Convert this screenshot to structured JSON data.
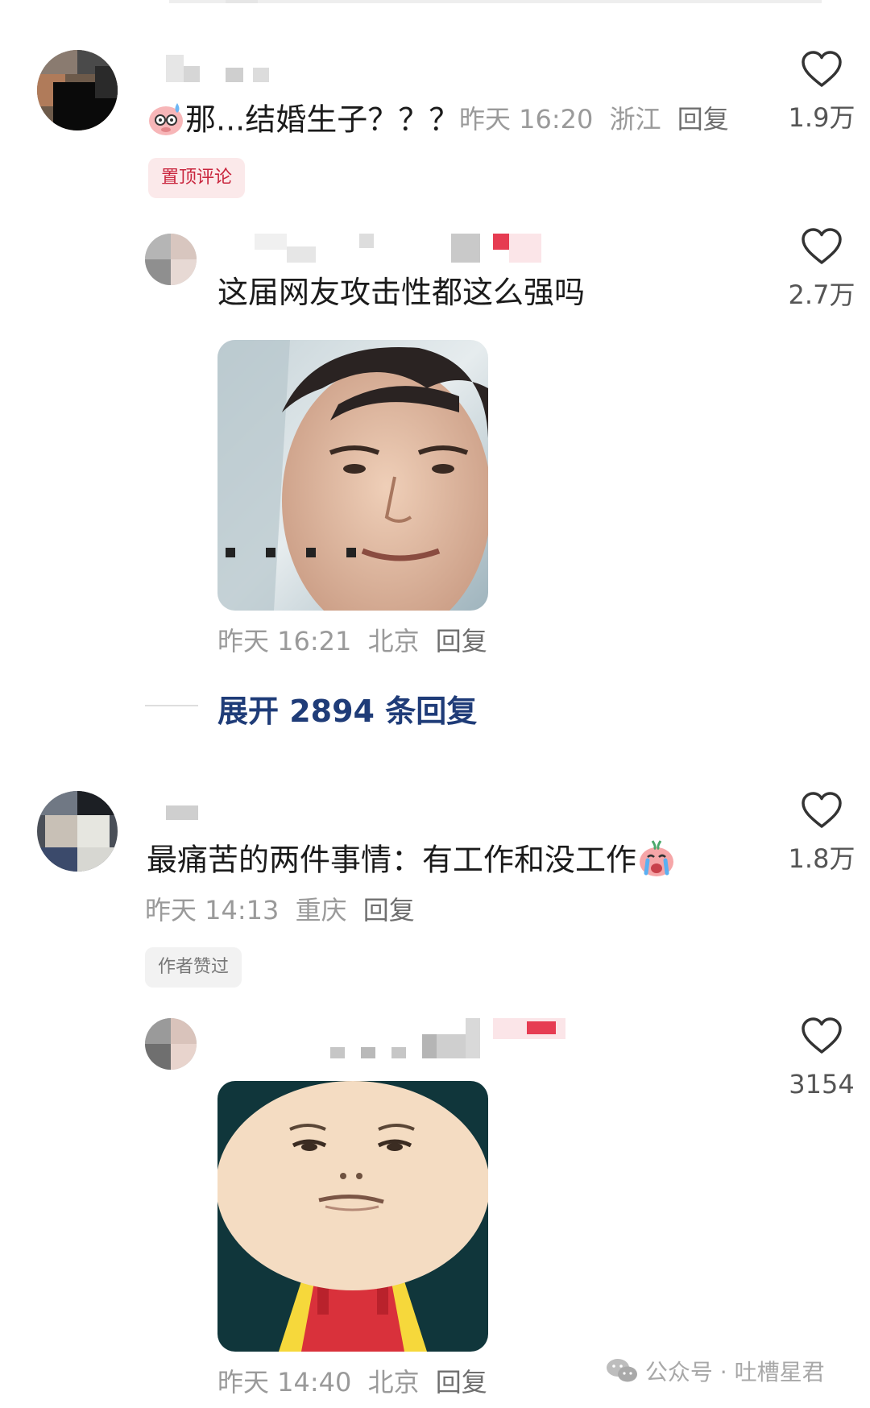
{
  "comments": [
    {
      "text": "那...结婚生子？？？",
      "time": "昨天 16:20",
      "location": "浙江",
      "reply_label": "回复",
      "likes": "1.9万",
      "tag": "置顶评论",
      "emoji": "sweating-pig-emoji",
      "replies": [
        {
          "text": "这届网友攻击性都这么强吗",
          "time": "昨天 16:21",
          "location": "北京",
          "reply_label": "回复",
          "likes": "2.7万",
          "sticker": "smiling-man-sticker"
        }
      ],
      "expand_label": "展开 2894 条回复"
    },
    {
      "text": "最痛苦的两件事情：有工作和没工作",
      "time": "昨天 14:13",
      "location": "重庆",
      "reply_label": "回复",
      "likes": "1.8万",
      "tag": "作者赞过",
      "emoji": "crying-pig-emoji",
      "replies": [
        {
          "time": "昨天 14:40",
          "location": "北京",
          "reply_label": "回复",
          "likes": "3154",
          "sticker": "round-face-cartoon-sticker"
        }
      ]
    }
  ],
  "watermark": "公众号 · 吐槽星君",
  "colors": {
    "accent_blue": "#1f3c78",
    "meta_gray": "#9a9a9a",
    "hot_tag_red": "#c9263e"
  },
  "icons": {
    "like": "heart-outline-icon",
    "watermark": "wechat-icon"
  }
}
